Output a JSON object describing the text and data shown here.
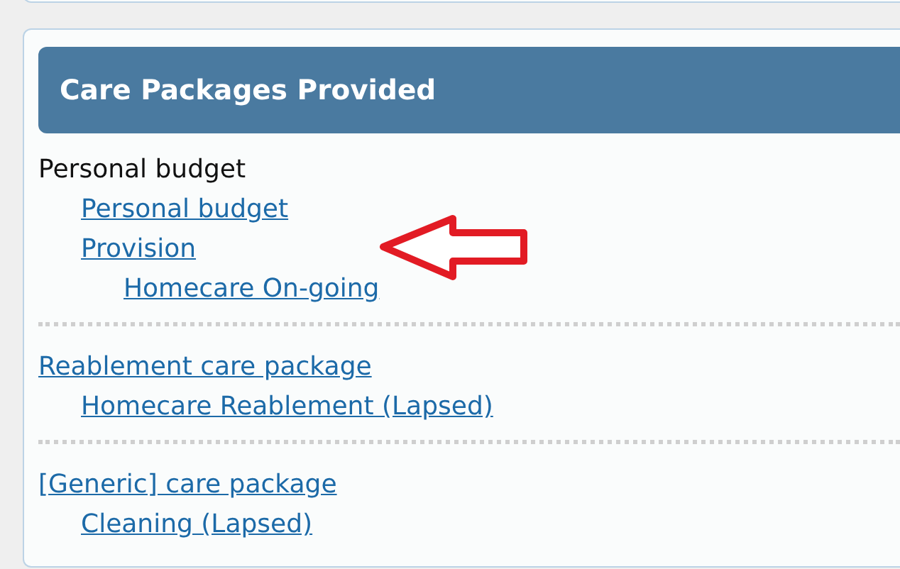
{
  "panel": {
    "title": "Care Packages Provided",
    "groups": [
      {
        "label": "Personal budget",
        "kind": "text",
        "children": [
          {
            "label": "Personal budget",
            "kind": "link"
          },
          {
            "label": "Provision",
            "kind": "link",
            "children": [
              {
                "label": "Homecare On-going",
                "kind": "link"
              }
            ]
          }
        ]
      },
      {
        "label": "Reablement care package",
        "kind": "link",
        "children": [
          {
            "label": "Homecare Reablement (Lapsed)",
            "kind": "link"
          }
        ]
      },
      {
        "label": "[Generic] care package",
        "kind": "link",
        "children": [
          {
            "label": "Cleaning (Lapsed)",
            "kind": "link"
          }
        ]
      }
    ]
  }
}
